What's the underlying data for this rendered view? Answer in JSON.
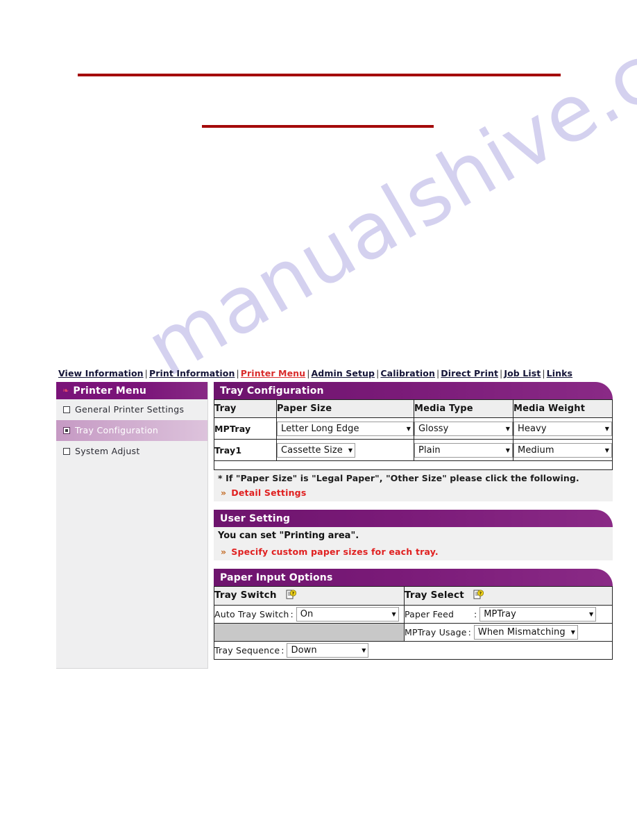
{
  "watermark": {
    "text": "manualshive.com"
  },
  "nav": {
    "items": [
      {
        "label": "View Information",
        "active": false
      },
      {
        "label": "Print Information",
        "active": false
      },
      {
        "label": "Printer Menu",
        "active": true
      },
      {
        "label": "Admin Setup",
        "active": false
      },
      {
        "label": "Calibration",
        "active": false
      },
      {
        "label": "Direct Print",
        "active": false
      },
      {
        "label": "Job List",
        "active": false
      },
      {
        "label": "Links",
        "active": false
      }
    ],
    "separator": "|"
  },
  "sidebar": {
    "title": "Printer Menu",
    "items": [
      {
        "label": "General Printer Settings",
        "selected": false
      },
      {
        "label": "Tray Configuration",
        "selected": true
      },
      {
        "label": "System Adjust",
        "selected": false
      }
    ]
  },
  "tray_configuration": {
    "title": "Tray Configuration",
    "columns": [
      "Tray",
      "Paper Size",
      "Media Type",
      "Media Weight"
    ],
    "rows": [
      {
        "tray": "MPTray",
        "paper_size": "Letter Long Edge",
        "media_type": "Glossy",
        "media_weight": "Heavy"
      },
      {
        "tray": "Tray1",
        "paper_size": "Cassette Size",
        "media_type": "Plain",
        "media_weight": "Medium"
      }
    ],
    "note": "* If \"Paper Size\" is \"Legal Paper\", \"Other Size\" please click the following.",
    "detail_link": "Detail Settings",
    "link_chevron": "»"
  },
  "user_setting": {
    "title": "User Setting",
    "description": "You can set \"Printing area\".",
    "custom_link": "Specify custom paper sizes for each tray.",
    "link_chevron": "»"
  },
  "paper_input_options": {
    "title": "Paper Input Options",
    "tray_switch": {
      "header": "Tray Switch",
      "help_icon": "help-document-icon",
      "auto_tray_switch_label": "Auto Tray Switch",
      "auto_tray_switch_value": "On",
      "tray_sequence_label": "Tray Sequence",
      "tray_sequence_value": "Down"
    },
    "tray_select": {
      "header": "Tray Select",
      "help_icon": "help-document-icon",
      "paper_feed_label": "Paper Feed",
      "paper_feed_value": "MPTray",
      "mptray_usage_label": "MPTray Usage",
      "mptray_usage_value": "When Mismatching"
    },
    "colon": ":"
  },
  "colors": {
    "purple_header": "#7a1379",
    "selected_row": "#d3b2d2",
    "accent_red": "#e02020",
    "rule_red": "#a40a0a",
    "panel_grey": "#f0f0f0"
  },
  "caret": "▼"
}
